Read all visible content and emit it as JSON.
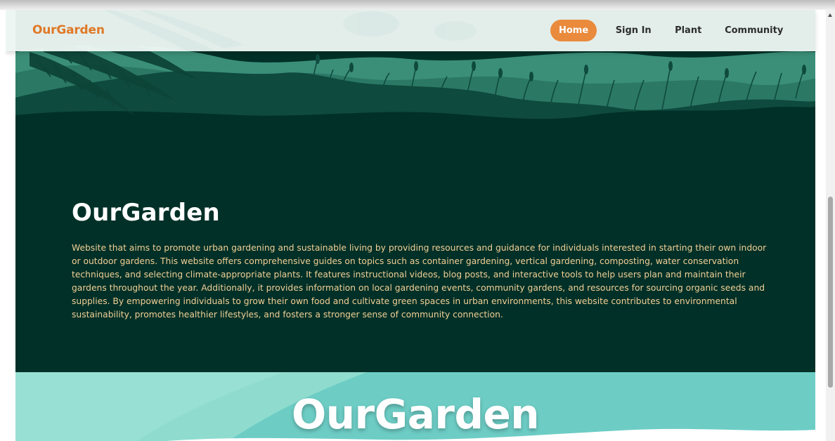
{
  "nav": {
    "brand": "OurGarden",
    "links": [
      {
        "label": "Home",
        "active": true
      },
      {
        "label": "Sign In",
        "active": false
      },
      {
        "label": "Plant",
        "active": false
      },
      {
        "label": "Community",
        "active": false
      }
    ]
  },
  "hero": {
    "title": "OurGarden",
    "description": "Website that aims to promote urban gardening and sustainable living by providing resources and guidance for individuals interested in starting their own indoor or outdoor gardens. This website offers comprehensive guides on topics such as container gardening, vertical gardening, composting, water conservation techniques, and selecting climate-appropriate plants. It features instructional videos, blog posts, and interactive tools to help users plan and maintain their gardens throughout the year. Additionally, it provides information on local gardening events, community gardens, and resources for sourcing organic seeds and supplies. By empowering individuals to grow their own food and cultivate green spaces in urban environments, this website contributes to environmental sustainability, promotes healthier lifestyles, and fosters a stronger sense of community connection."
  },
  "section2": {
    "title": "OurGarden"
  },
  "colors": {
    "brand": "#e07826",
    "active_pill": "#ea8a3c",
    "hero_bg": "#003027",
    "hero_text": "#f3cf96",
    "section2_bg": "#6dcdc5"
  }
}
